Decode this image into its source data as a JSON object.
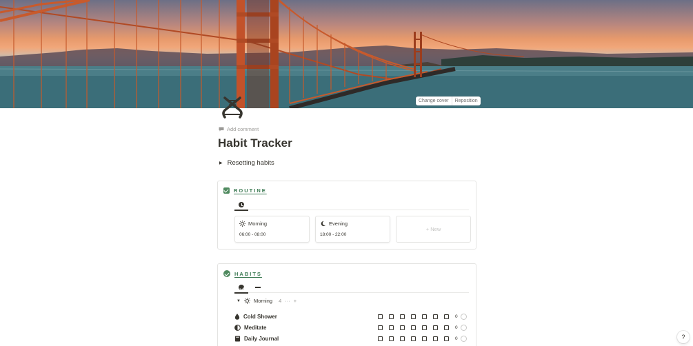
{
  "cover": {
    "change_cover": "Change cover",
    "reposition": "Reposition"
  },
  "page": {
    "icon": "dna-icon",
    "add_comment": "Add comment",
    "title": "Habit Tracker",
    "toggle_label": "Resetting habits"
  },
  "routine": {
    "header": "ROUTINE",
    "view_icon": "clock-icon",
    "cards": [
      {
        "title": "Morning",
        "icon": "sun-icon",
        "time": "06:00 - 08:00"
      },
      {
        "title": "Evening",
        "icon": "moon-icon",
        "time": "18:00 - 22:00"
      }
    ],
    "new_label": "+ New"
  },
  "habits": {
    "header": "HABITS",
    "views": [
      "check-circle-icon",
      "dash-icon"
    ],
    "group": {
      "name": "Morning",
      "count": "4",
      "more": "···",
      "add": "+"
    },
    "rows": [
      {
        "name": "Cold Shower",
        "icon": "drop-icon",
        "count": "0"
      },
      {
        "name": "Meditate",
        "icon": "half-circle-icon",
        "count": "0"
      },
      {
        "name": "Daily Journal",
        "icon": "journal-icon",
        "count": "0"
      }
    ]
  },
  "help": "?"
}
